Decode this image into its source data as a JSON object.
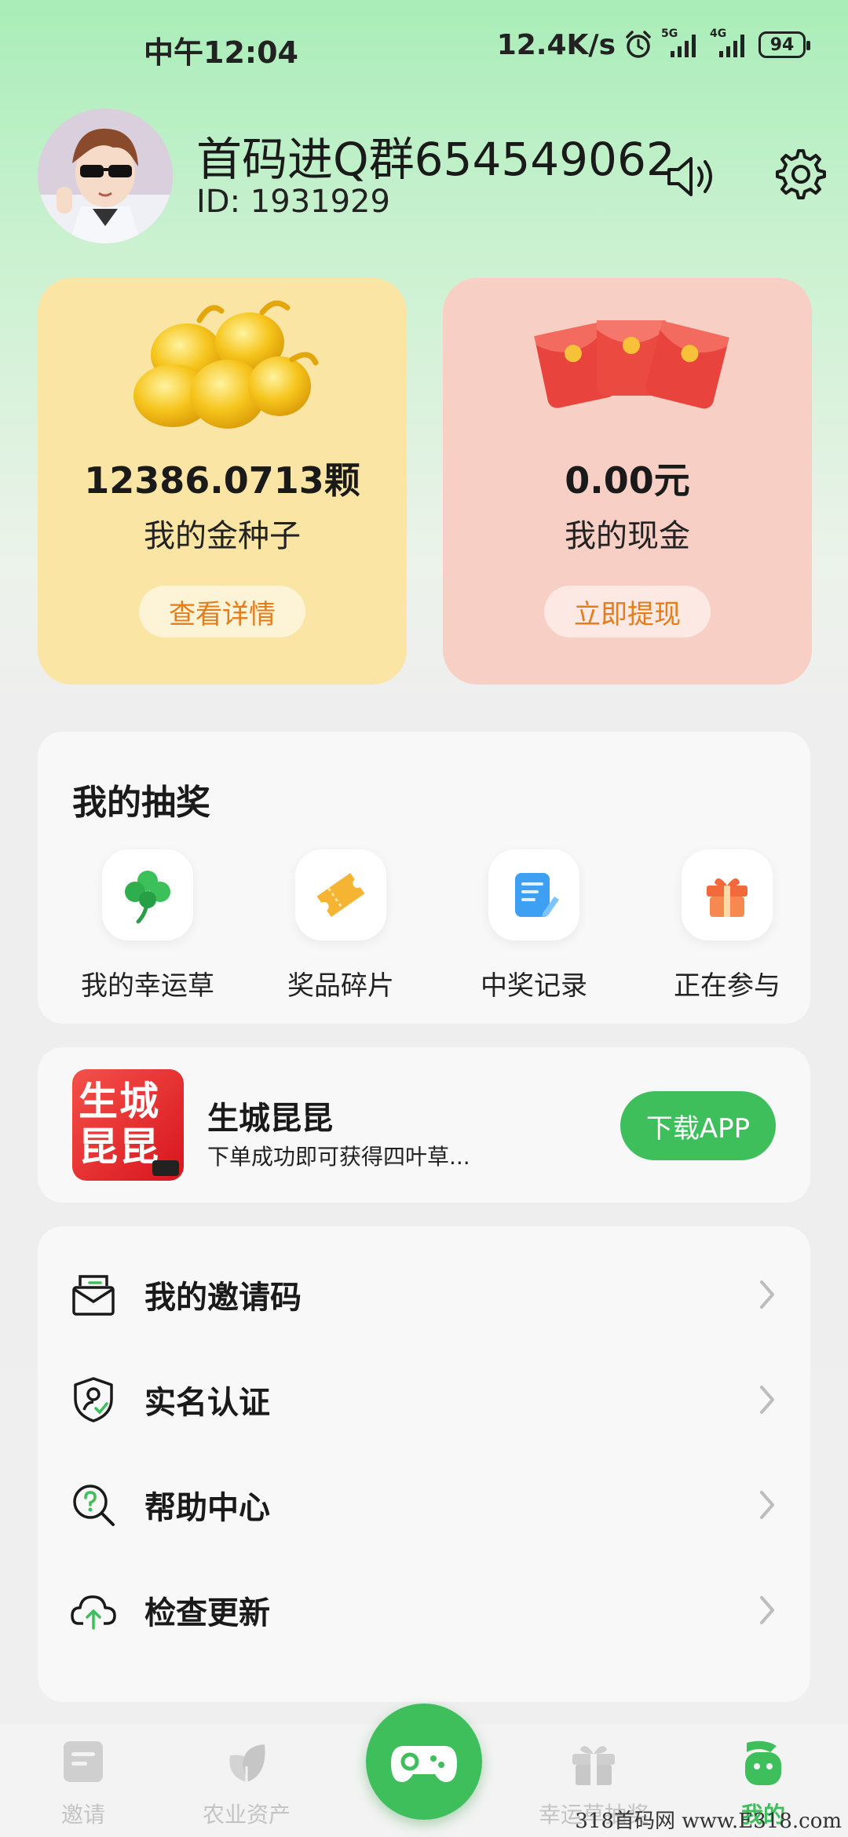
{
  "status_bar": {
    "time": "中午12:04",
    "net_speed": "12.4K/s",
    "network_1": "5G",
    "network_2": "4G",
    "battery": "94"
  },
  "profile": {
    "nickname": "首码进Q群654549062",
    "id_text": "ID: 1931929"
  },
  "assets": {
    "seed": {
      "value": "12386.0713颗",
      "label": "我的金种子",
      "button": "查看详情"
    },
    "cash": {
      "value": "0.00元",
      "label": "我的现金",
      "button": "立即提现"
    }
  },
  "lottery": {
    "title": "我的抽奖",
    "items": [
      {
        "label": "我的幸运草",
        "icon": "clover-icon"
      },
      {
        "label": "奖品碎片",
        "icon": "ticket-icon"
      },
      {
        "label": "中奖记录",
        "icon": "document-icon"
      },
      {
        "label": "正在参与",
        "icon": "gift-box-icon"
      }
    ]
  },
  "promo": {
    "logo_text": "生城昆昆",
    "name": "生城昆昆",
    "description": "下单成功即可获得四叶草...",
    "button": "下载APP"
  },
  "menu": {
    "items": [
      {
        "label": "我的邀请码",
        "icon": "invite-envelope-icon"
      },
      {
        "label": "实名认证",
        "icon": "shield-user-icon"
      },
      {
        "label": "帮助中心",
        "icon": "help-search-icon"
      },
      {
        "label": "检查更新",
        "icon": "cloud-upload-icon"
      }
    ]
  },
  "bottom_nav": {
    "items": [
      {
        "label": "邀请",
        "active": false
      },
      {
        "label": "农业资产",
        "active": false
      },
      {
        "label": "幸运草抽奖",
        "active": false
      },
      {
        "label": "我的",
        "active": true
      }
    ]
  },
  "watermark": "318首码网 www.E318.com",
  "colors": {
    "accent_green": "#3fbf5c",
    "seed_card": "#fbe5a4",
    "cash_card": "#f8cfc4",
    "button_orange_text": "#e47d1a"
  }
}
